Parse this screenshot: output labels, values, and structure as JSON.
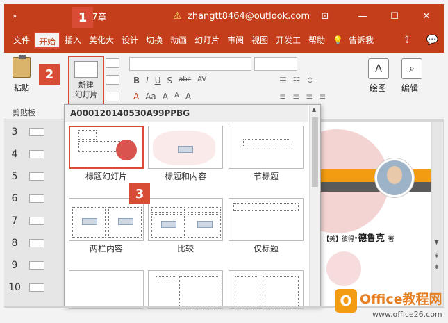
{
  "titlebar": {
    "quick_access": "»",
    "doc_title": "17章",
    "warning_icon": "⚠",
    "account": "zhangtt8464@outlook.com",
    "ribbon_display_icon": "⊡",
    "minimize": "—",
    "maximize": "☐",
    "close": "✕"
  },
  "tabs": [
    {
      "label": "文件"
    },
    {
      "label": "开始"
    },
    {
      "label": "插入"
    },
    {
      "label": "美化大"
    },
    {
      "label": "设计"
    },
    {
      "label": "切换"
    },
    {
      "label": "动画"
    },
    {
      "label": "幻灯片"
    },
    {
      "label": "审阅"
    },
    {
      "label": "视图"
    },
    {
      "label": "开发工"
    },
    {
      "label": "帮助"
    },
    {
      "label": "告诉我"
    }
  ],
  "tab_active": "开始",
  "tell_me_icon": "💡",
  "share_icon": "⇪",
  "comment_icon": "💬",
  "ribbon": {
    "paste_label": "粘贴",
    "new_slide_label_1": "新建",
    "new_slide_label_2": "幻灯片",
    "clipboard_group": "剪贴板",
    "bold": "B",
    "italic": "I",
    "underline": "U",
    "shadow": "S",
    "strike": "abc",
    "spacing": "AV",
    "font_color": "A",
    "font_size_up": "A",
    "font_size_down": "A",
    "case": "Aa",
    "clear": "A",
    "draw_label": "绘图",
    "edit_label": "编辑"
  },
  "slide_numbers": [
    "3",
    "4",
    "5",
    "6",
    "7",
    "8",
    "9",
    "10"
  ],
  "gallery": {
    "header": "A000120140530A99PPBG",
    "layouts": [
      {
        "label": "标题幻灯片"
      },
      {
        "label": "标题和内容"
      },
      {
        "label": "节标题"
      },
      {
        "label": "两栏内容"
      },
      {
        "label": "比较"
      },
      {
        "label": "仅标题"
      }
    ]
  },
  "slide": {
    "author_prefix": "【美】彼得",
    "author_name": "德鲁克",
    "author_suffix": "著"
  },
  "badges": [
    "1",
    "2",
    "3"
  ],
  "watermark": {
    "logo": "O",
    "brand": "Office教程网",
    "url": "www.office26.com"
  },
  "colors": {
    "accent": "#c43e1c",
    "badge": "#d84b34",
    "orange": "#f39c12"
  }
}
